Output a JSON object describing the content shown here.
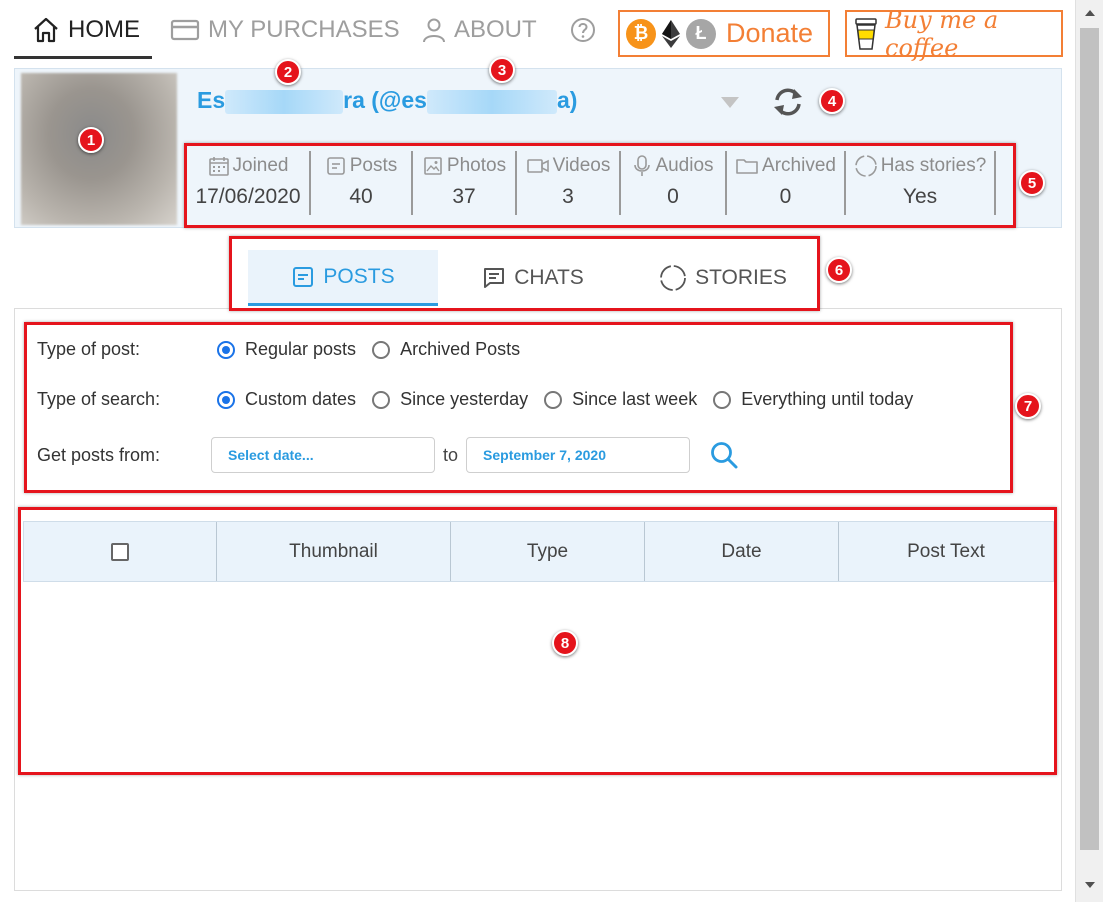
{
  "nav": {
    "home": "HOME",
    "purchases": "MY PURCHASES",
    "about": "ABOUT",
    "donate": "Donate",
    "coffee": "Buy me a coffee"
  },
  "profile": {
    "name_prefix": "Es",
    "name_mid": "ra (@es",
    "name_suffix": "a)",
    "stats": [
      {
        "label": "Joined",
        "value": "17/06/2020",
        "icon": "calendar-icon"
      },
      {
        "label": "Posts",
        "value": "40",
        "icon": "post-icon"
      },
      {
        "label": "Photos",
        "value": "37",
        "icon": "photo-icon"
      },
      {
        "label": "Videos",
        "value": "3",
        "icon": "video-icon"
      },
      {
        "label": "Audios",
        "value": "0",
        "icon": "microphone-icon"
      },
      {
        "label": "Archived",
        "value": "0",
        "icon": "folder-icon"
      },
      {
        "label": "Has stories?",
        "value": "Yes",
        "icon": "stories-icon"
      }
    ]
  },
  "tabs": [
    {
      "label": "POSTS",
      "icon": "post-icon",
      "active": true
    },
    {
      "label": "CHATS",
      "icon": "chat-icon",
      "active": false
    },
    {
      "label": "STORIES",
      "icon": "stories-icon",
      "active": false
    }
  ],
  "filters": {
    "type_of_post_label": "Type of post:",
    "type_of_post_options": [
      "Regular posts",
      "Archived Posts"
    ],
    "type_of_search_label": "Type of search:",
    "type_of_search_options": [
      "Custom dates",
      "Since yesterday",
      "Since last week",
      "Everything until today"
    ],
    "get_posts_label": "Get posts from:",
    "from_placeholder": "Select date...",
    "to_label": "to",
    "to_value": "September 7, 2020"
  },
  "table": {
    "columns": [
      "Thumbnail",
      "Type",
      "Date",
      "Post Text"
    ]
  },
  "annotations": [
    "1",
    "2",
    "3",
    "4",
    "5",
    "6",
    "7",
    "8"
  ],
  "colors": {
    "accent": "#2a9be0",
    "donate": "#f37f35",
    "annotation": "#e5141c",
    "header_bg": "#eef5fb"
  }
}
